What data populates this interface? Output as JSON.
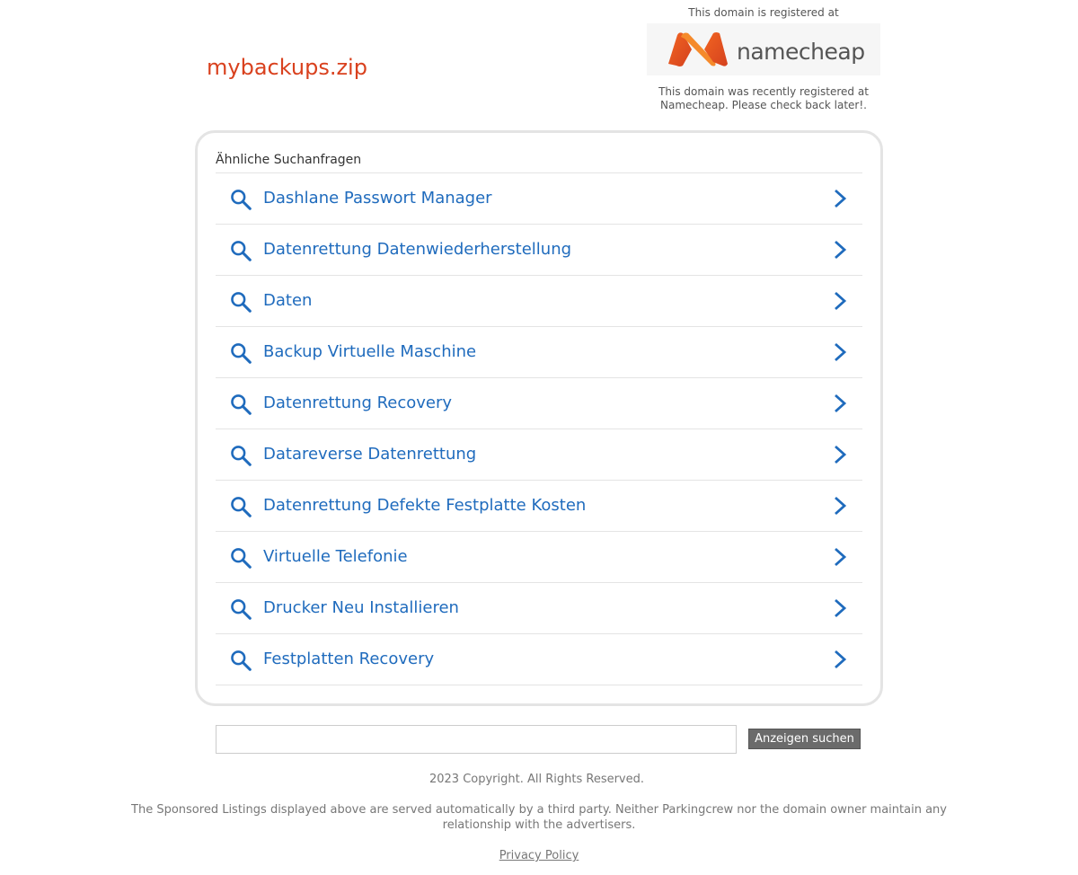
{
  "header": {
    "domain_title": "mybackups.zip"
  },
  "registrar": {
    "intro_text": "This domain is registered at",
    "logo_text": "namecheap",
    "notice_text": "This domain was recently registered at Namecheap. Please check back later!."
  },
  "related_searches": {
    "heading": "Ähnliche Suchanfragen",
    "items": [
      {
        "label": "Dashlane Passwort Manager"
      },
      {
        "label": "Datenrettung Datenwiederherstellung"
      },
      {
        "label": "Daten"
      },
      {
        "label": "Backup Virtuelle Maschine"
      },
      {
        "label": "Datenrettung Recovery"
      },
      {
        "label": "Datareverse Datenrettung"
      },
      {
        "label": "Datenrettung Defekte Festplatte Kosten"
      },
      {
        "label": "Virtuelle Telefonie"
      },
      {
        "label": "Drucker Neu Installieren"
      },
      {
        "label": "Festplatten Recovery"
      }
    ]
  },
  "search_form": {
    "input_value": "",
    "button_label": "Anzeigen suchen"
  },
  "footer": {
    "copyright": "2023 Copyright. All Rights Reserved.",
    "disclaimer": "The Sponsored Listings displayed above are served automatically by a third party. Neither Parkingcrew nor the domain owner maintain any relationship with the advertisers.",
    "privacy_label": "Privacy Policy"
  },
  "colors": {
    "accent_link": "#1f6bbd",
    "domain_title": "#d9411e",
    "namecheap_orange": "#f4511e"
  }
}
